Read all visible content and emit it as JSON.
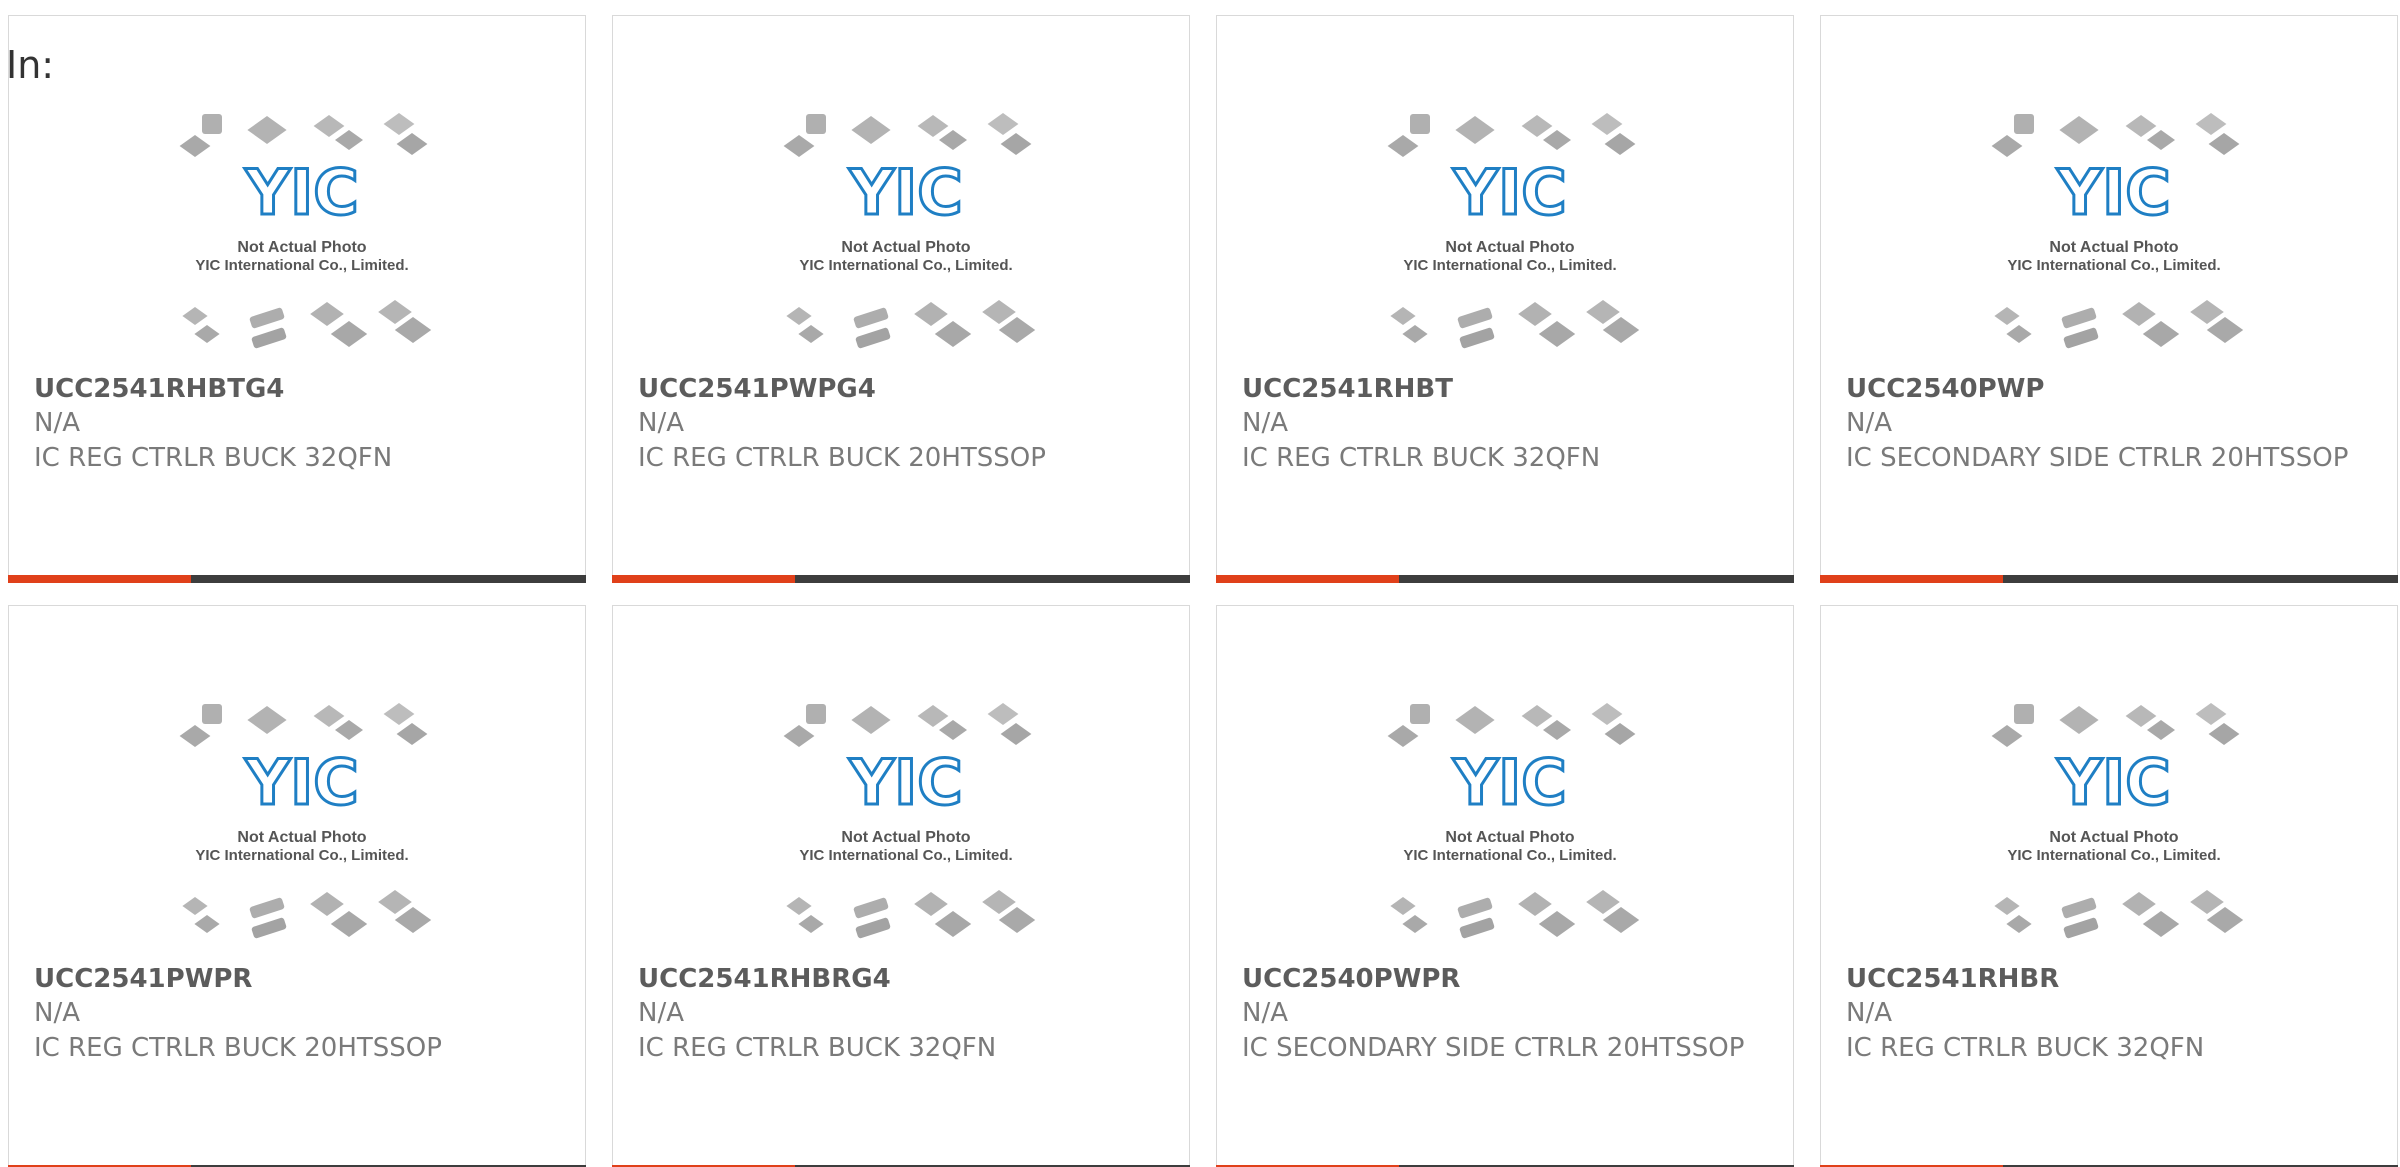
{
  "header": {
    "in_label": "In:"
  },
  "thumbnail": {
    "brand_text": "YIC",
    "caption_line1": "Not Actual Photo",
    "caption_line2": "YIC International Co., Limited.",
    "brand_color": "#1f7fc4",
    "icon": "chip-placeholder-icon"
  },
  "colors": {
    "accent_bar": "#e0401a",
    "dark_bar": "#3d3d3d",
    "part_text": "#5c5c5c",
    "body_text": "#7a7a7a"
  },
  "products": [
    {
      "part": "UCC2541RHBTG4",
      "manufacturer": "N/A",
      "description": "IC REG CTRLR BUCK 32QFN"
    },
    {
      "part": "UCC2541PWPG4",
      "manufacturer": "N/A",
      "description": "IC REG CTRLR BUCK 20HTSSOP"
    },
    {
      "part": "UCC2541RHBT",
      "manufacturer": "N/A",
      "description": "IC REG CTRLR BUCK 32QFN"
    },
    {
      "part": "UCC2540PWP",
      "manufacturer": "N/A",
      "description": "IC SECONDARY SIDE CTRLR 20HTSSOP"
    },
    {
      "part": "UCC2541PWPR",
      "manufacturer": "N/A",
      "description": "IC REG CTRLR BUCK 20HTSSOP"
    },
    {
      "part": "UCC2541RHBRG4",
      "manufacturer": "N/A",
      "description": "IC REG CTRLR BUCK 32QFN"
    },
    {
      "part": "UCC2540PWPR",
      "manufacturer": "N/A",
      "description": "IC SECONDARY SIDE CTRLR 20HTSSOP"
    },
    {
      "part": "UCC2541RHBR",
      "manufacturer": "N/A",
      "description": "IC REG CTRLR BUCK 32QFN"
    }
  ]
}
